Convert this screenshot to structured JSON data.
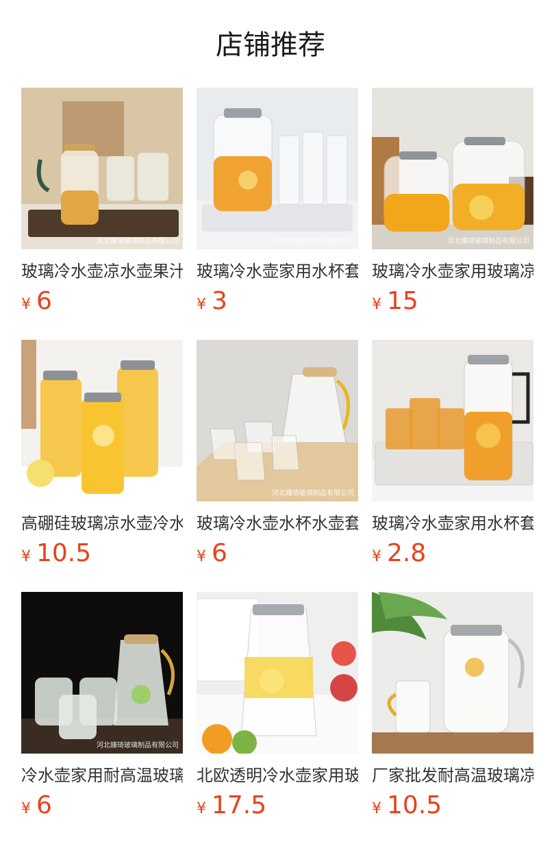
{
  "page": {
    "title": "店铺推荐"
  },
  "currency_symbol": "¥",
  "products": [
    {
      "name": "玻璃冷水壶凉水壶果汁壶",
      "price": "6",
      "watermark": "河北臻琦玻璃制品有限公司"
    },
    {
      "name": "玻璃冷水壶家用水杯套装",
      "price": "3",
      "watermark": "河北臻琦玻璃制品有限公司"
    },
    {
      "name": "玻璃冷水壶家用玻璃凉水壶",
      "price": "15",
      "watermark": "河北臻琦玻璃制品有限公司"
    },
    {
      "name": "高硼硅玻璃凉水壶冷水壶",
      "price": "10.5",
      "watermark": ""
    },
    {
      "name": "玻璃冷水壶水杯水壶套装",
      "price": "6",
      "watermark": "河北臻琦玻璃制品有限公司"
    },
    {
      "name": "玻璃冷水壶家用水杯套装",
      "price": "2.8",
      "watermark": ""
    },
    {
      "name": "冷水壶家用耐高温玻璃壶",
      "price": "6",
      "watermark": "河北臻琦玻璃制品有限公司"
    },
    {
      "name": "北欧透明冷水壶家用玻璃",
      "price": "17.5",
      "watermark": ""
    },
    {
      "name": "厂家批发耐高温玻璃凉水壶",
      "price": "10.5",
      "watermark": ""
    }
  ]
}
